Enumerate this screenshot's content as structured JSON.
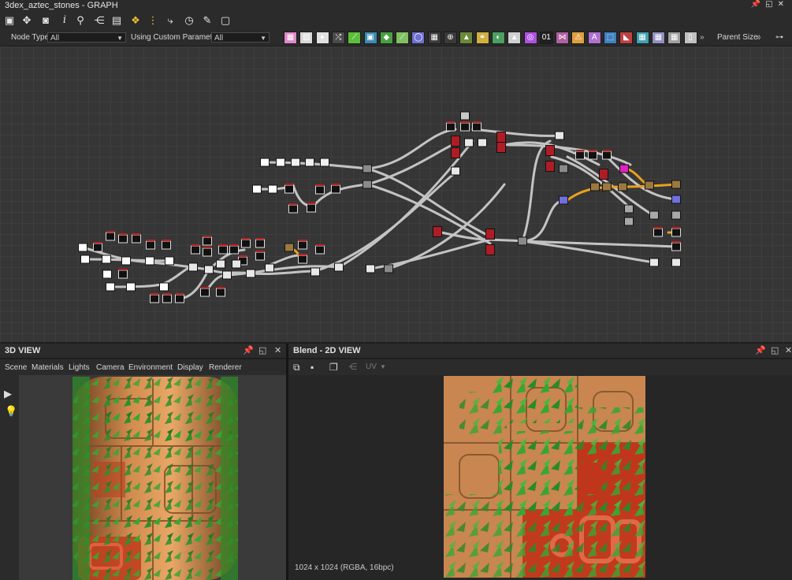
{
  "graph_panel": {
    "title": "3dex_aztec_stones - GRAPH",
    "filter": {
      "node_type_label": "Node Type",
      "node_type_value": "All",
      "custom_params_label": "Using Custom Parameters",
      "custom_params_value": "All",
      "parent_size_label": "Parent Size:"
    },
    "toolbar_icons": [
      "frame-icon",
      "move-icon",
      "screenshot-icon",
      "info-icon",
      "search-icon",
      "share-icon",
      "table-icon",
      "python-icon",
      "graph-icon",
      "flow-icon",
      "timer-icon",
      "tools-icon",
      "export-icon"
    ],
    "node_palette_icons": [
      "image-icon",
      "grayscale-icon",
      "drop-icon",
      "shuffle-icon",
      "curve-icon",
      "blur-icon",
      "droplet-icon",
      "gradient-icon",
      "circle-icon",
      "tile-icon",
      "warp-icon",
      "levels-icon",
      "blend-icon",
      "pie-icon",
      "histogram-icon",
      "hue-icon",
      "text-icon",
      "bool-icon",
      "warning-icon",
      "letter-a-icon",
      "frame-select-icon",
      "paint-icon",
      "uv-icon",
      "transform-icon",
      "emboss-icon",
      "split-icon"
    ]
  },
  "view3d": {
    "title": "3D VIEW",
    "menu": [
      "Scene",
      "Materials",
      "Lights",
      "Camera",
      "Environment",
      "Display",
      "Renderer"
    ]
  },
  "view2d": {
    "title": "Blend - 2D VIEW",
    "uv_label": "UV",
    "status": "1024 x 1024 (RGBA, 16bpc)"
  },
  "colors": {
    "panel": "#2b2b2b",
    "graph_bg": "#363636",
    "link": "#d6d6d6",
    "link_active": "#f0a020",
    "node_red": "#b01c24",
    "node_magenta": "#e020c0",
    "node_blue": "#7070e0"
  }
}
